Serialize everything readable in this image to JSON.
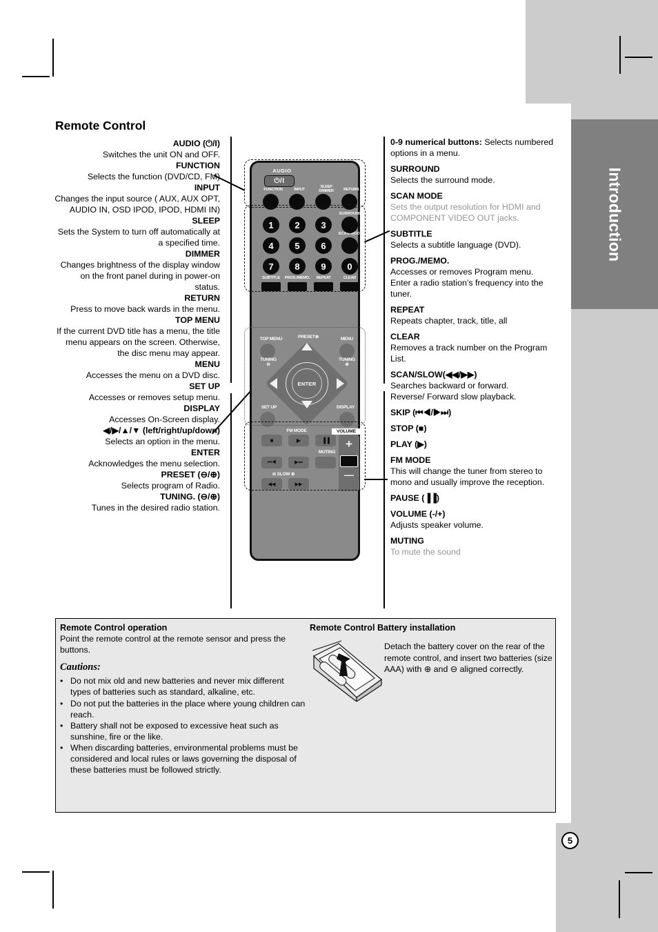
{
  "page": {
    "title": "Remote Control",
    "tab_label": "Introduction",
    "page_number": "5"
  },
  "left_column": [
    {
      "heading": "AUDIO (⏻/I)",
      "body": "Switches the unit ON and OFF."
    },
    {
      "heading": "FUNCTION",
      "body": "Selects the function (DVD/CD, FM)"
    },
    {
      "heading": "INPUT",
      "body": "Changes the input source ( AUX, AUX OPT, AUDIO IN, OSD IPOD, IPOD, HDMI IN)"
    },
    {
      "heading": "SLEEP",
      "body": "Sets the System to turn off automatically at a specified time."
    },
    {
      "heading": "DIMMER",
      "body": "Changes brightness of the display window on the front panel during in power-on status."
    },
    {
      "heading": "RETURN",
      "body": "Press to move back wards in the menu."
    },
    {
      "heading": "TOP MENU",
      "body": "If the current DVD title has a menu, the title menu appears on the screen. Otherwise, the disc menu may appear."
    },
    {
      "heading": "MENU",
      "body": "Accesses the menu on a DVD disc."
    },
    {
      "heading": "SET UP",
      "body": "Accesses or removes setup menu."
    },
    {
      "heading": "DISPLAY",
      "body": "Accesses On-Screen display."
    },
    {
      "heading": "◀/▶/▲/▼ (left/right/up/down)",
      "body": "Selects an option in the menu."
    },
    {
      "heading": "ENTER",
      "body": "Acknowledges the menu selection."
    },
    {
      "heading": "PRESET (⊖/⊕)",
      "body": "Selects program of Radio."
    },
    {
      "heading": "TUNING. (⊖/⊕)",
      "body": "Tunes in the desired radio station."
    }
  ],
  "right_column": [
    {
      "heading": "0-9 numerical buttons:",
      "body": " Selects numbered options in a menu.",
      "inline": true,
      "gray": false
    },
    {
      "heading": "SURROUND",
      "body": "Selects the surround mode.",
      "gray": false
    },
    {
      "heading": "SCAN MODE",
      "body": "Sets the output resolution for HDMI and COMPONENT VIDEO OUT jacks.",
      "gray": true
    },
    {
      "heading": "SUBTITLE",
      "body": "Selects a subtitle language (DVD).",
      "gray": false
    },
    {
      "heading": "PROG./MEMO.",
      "body": "Accesses or removes Program menu.\nEnter a radio station’s frequency into the tuner.",
      "gray": false
    },
    {
      "heading": "REPEAT",
      "body": "Repeats chapter, track, title, all",
      "gray": false
    },
    {
      "heading": "CLEAR",
      "body": "Removes a track number on the Program List.",
      "gray": false
    },
    {
      "heading": "SCAN/SLOW(◀◀/▶▶)",
      "body": "Searches backward or forward.\nReverse/ Forward slow playback.",
      "gray": false
    },
    {
      "heading": "SKIP (⏮◀/▶⏭)",
      "body": "",
      "gray": false
    },
    {
      "heading": "STOP (■)",
      "body": "",
      "gray": false
    },
    {
      "heading": "PLAY (▶)",
      "body": "",
      "gray": false
    },
    {
      "heading": "FM MODE",
      "body": "This will change the tuner from stereo to mono and usually improve the reception.",
      "gray": false
    },
    {
      "heading": "PAUSE (▐▐)",
      "body": "",
      "gray": false
    },
    {
      "heading": "VOLUME (-/+)",
      "body": "Adjusts speaker volume.",
      "gray": false
    },
    {
      "heading": "MUTING",
      "body": "To mute the sound",
      "gray": true
    }
  ],
  "remote": {
    "audio_label": "AUDIO",
    "power_glyph": "⏻/I",
    "row1": [
      "FUNCTION",
      "INPUT",
      "SLEEP\nDIMMER",
      "RETURN"
    ],
    "surround_label": "SURROUND",
    "scan_mode_label": "SCAN MODE",
    "numbers": [
      "1",
      "2",
      "3",
      "4",
      "5",
      "6",
      "7",
      "8",
      "9",
      "0"
    ],
    "row_bottom_labels": [
      "SUBTITLE",
      "PROG./MEMO.",
      "REPEAT",
      "CLEAR"
    ],
    "top_menu_label": "TOP MENU",
    "menu_label": "MENU",
    "tuning_minus_label": "TUNING",
    "tuning_minus_sign": "⊖",
    "tuning_plus_label": "TUNING",
    "tuning_plus_sign": "⊕",
    "preset_up_label": "PRESET",
    "preset_up_sign": "⊕",
    "preset_down_label": "PRESET",
    "preset_down_sign": "⊖",
    "set_up_label": "SET UP",
    "display_label": "DISPLAY",
    "enter_label": "ENTER",
    "fm_mode_label": "FM MODE",
    "volume_label": "VOLUME",
    "muting_label": "MUTING",
    "slow_label": "SLOW",
    "slow_minus": "⊖",
    "slow_plus": "⊕",
    "stop_glyph": "■",
    "play_glyph": "▶",
    "pause_glyph": "▐▐",
    "skip_back_glyph": "⏮◀",
    "skip_fwd_glyph": "▶⏭",
    "scan_back_glyph": "◀◀",
    "scan_fwd_glyph": "▶▶",
    "vol_plus": "+",
    "vol_minus": "—"
  },
  "bottom": {
    "operation_heading": "Remote Control operation",
    "operation_body": "Point the remote control at the remote sensor and press the buttons.",
    "cautions_heading": "Cautions:",
    "cautions": [
      "Do not mix old and new batteries and never mix different types of batteries such as standard, alkaline, etc.",
      "Do not put the batteries in the place where young children can reach.",
      "Battery shall not be exposed to excessive heat such as sunshine, fire or the like.",
      "When discarding batteries, environmental problems must be considered and local rules or laws governing the disposal of these batteries must be followed strictly."
    ],
    "bullet": "•",
    "battery_heading": "Remote Control Battery installation",
    "battery_body": "Detach the battery cover on the rear of the remote control, and insert two batteries (size AAA) with ⊕ and ⊖ aligned correctly."
  },
  "colors": {
    "tab_bg": "#808080",
    "strip_bg": "#cccccc",
    "remote_body": "#8a8a8a",
    "button_black": "#0b0b0b",
    "gray_text": "#969696",
    "box_bg": "#e8e8e8"
  }
}
